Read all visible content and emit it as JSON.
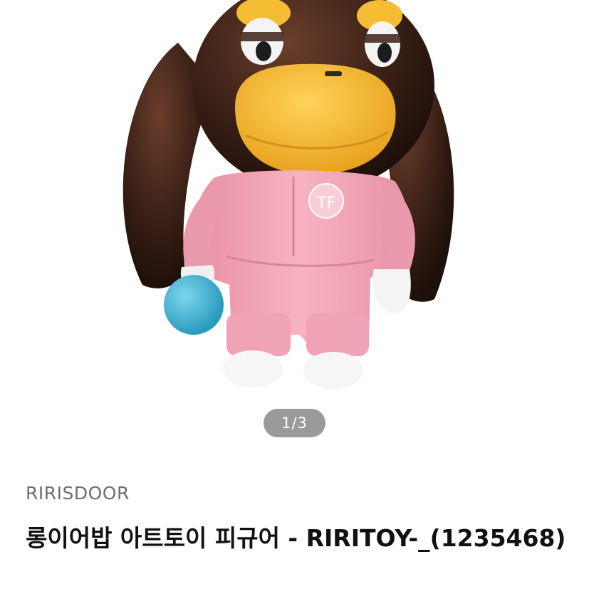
{
  "gallery": {
    "image_alt_icon": "toy-figure-image",
    "page_indicator": "1/3"
  },
  "product": {
    "seller": "RIRISDOOR",
    "title": "롱이어밥 아트토이 피규어 - RIRITOY-_(1235468)",
    "logo_text": "TF"
  },
  "colors": {
    "hair": "#3a2016",
    "beak": "#f2b630",
    "suit": "#f2a6b6",
    "ball": "#3fb2d3",
    "indicator_bg": "#9a9a9a"
  }
}
